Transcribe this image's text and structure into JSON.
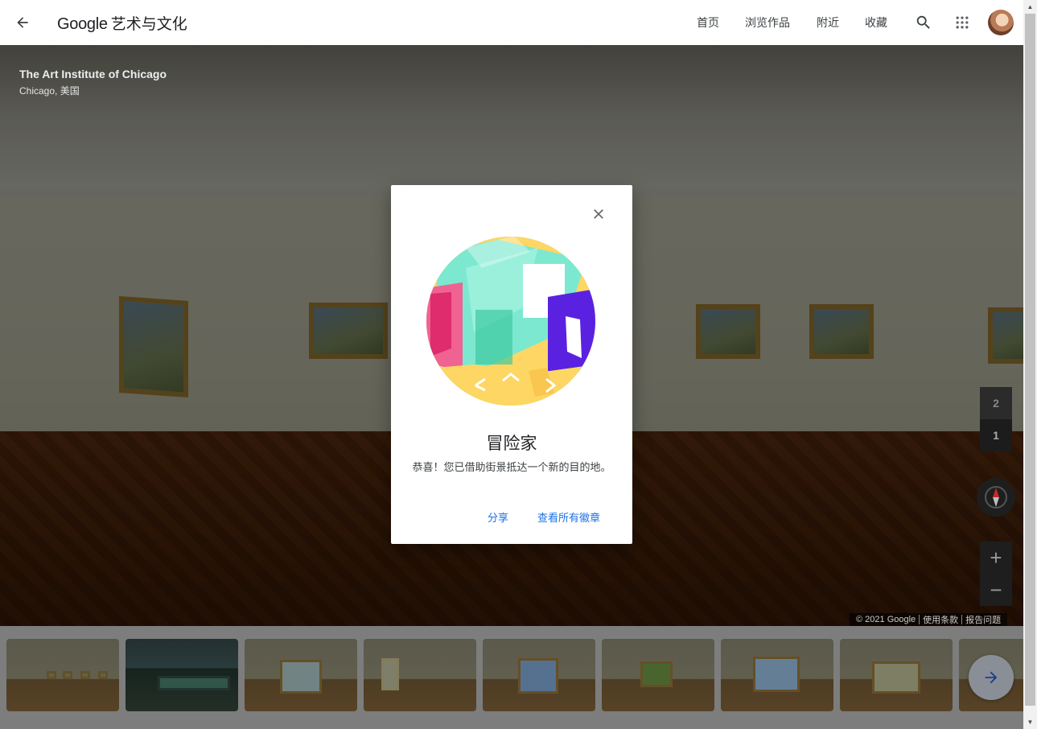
{
  "header": {
    "brand_google": "Google",
    "brand_product": "艺术与文化",
    "nav": {
      "home": "首页",
      "browse": "浏览作品",
      "nearby": "附近",
      "favorites": "收藏"
    },
    "icons": {
      "back": "arrow-left-icon",
      "search": "search-icon",
      "apps": "apps-grid-icon",
      "avatar": "user-avatar"
    }
  },
  "pano": {
    "title": "The Art Institute of Chicago",
    "subtitle": "Chicago, 美国",
    "floors": [
      "2",
      "1"
    ],
    "selected_floor": "1",
    "zoom_in": "+",
    "zoom_out": "−",
    "attribution": {
      "copyright": "© 2021 Google",
      "terms": "使用条款",
      "report": "报告问题"
    }
  },
  "dialog": {
    "title": "冒险家",
    "message": "恭喜！您已借助街景抵达一个新的目的地。",
    "share": "分享",
    "view_all_badges": "查看所有徽章",
    "colors": {
      "mint": "#7de8d0",
      "yellow": "#fdd663",
      "pink": "#f06292",
      "purple": "#5b21e0",
      "link": "#1a73e8"
    }
  },
  "strip": {
    "thumbnail_count": 9,
    "next_icon": "arrow-right-icon"
  }
}
